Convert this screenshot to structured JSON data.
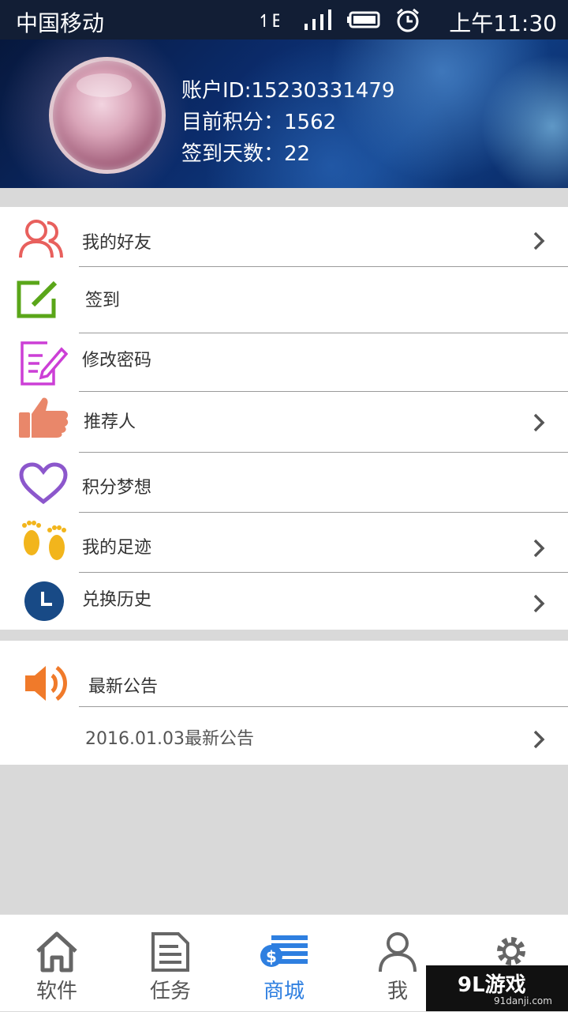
{
  "status_bar": {
    "carrier": "中国移动",
    "time": "上午11:30"
  },
  "profile": {
    "account_id": "账户ID:15230331479",
    "points": "目前积分：1562",
    "signin_days": "签到天数：22"
  },
  "menu": {
    "items": [
      {
        "label": "我的好友",
        "icon": "friends-icon",
        "icon_color": "#e8605d",
        "has_arrow": true
      },
      {
        "label": "签到",
        "icon": "signin-icon",
        "icon_color": "#5aa619",
        "has_arrow": false
      },
      {
        "label": "修改密码",
        "icon": "edit-document-icon",
        "icon_color": "#cc3fd6",
        "has_arrow": false
      },
      {
        "label": "推荐人",
        "icon": "thumbs-up-icon",
        "icon_color": "#e9876a",
        "has_arrow": true
      },
      {
        "label": "积分梦想",
        "icon": "heart-icon",
        "icon_color": "#8c57cc",
        "has_arrow": false
      },
      {
        "label": "我的足迹",
        "icon": "footprints-icon",
        "icon_color": "#f2b51c",
        "has_arrow": true
      },
      {
        "label": "兑换历史",
        "icon": "clock-icon",
        "icon_color": "#184a86",
        "has_arrow": true
      }
    ]
  },
  "notice": {
    "title": "最新公告",
    "item": "2016.01.03最新公告",
    "icon": "speaker-icon",
    "icon_color": "#f07a2a"
  },
  "tabs": [
    {
      "label": "软件",
      "icon": "home-icon"
    },
    {
      "label": "任务",
      "icon": "document-icon"
    },
    {
      "label": "商城",
      "icon": "store-icon",
      "active": true
    },
    {
      "label": "我",
      "icon": "person-icon"
    },
    {
      "label": "",
      "icon": "gear-icon"
    }
  ],
  "watermark": {
    "main": "9L游戏",
    "sub": "91danji.com"
  },
  "colors": {
    "accent": "#2e7fe0",
    "divider": "#9a9a9a",
    "background": "#d9d9d9"
  }
}
